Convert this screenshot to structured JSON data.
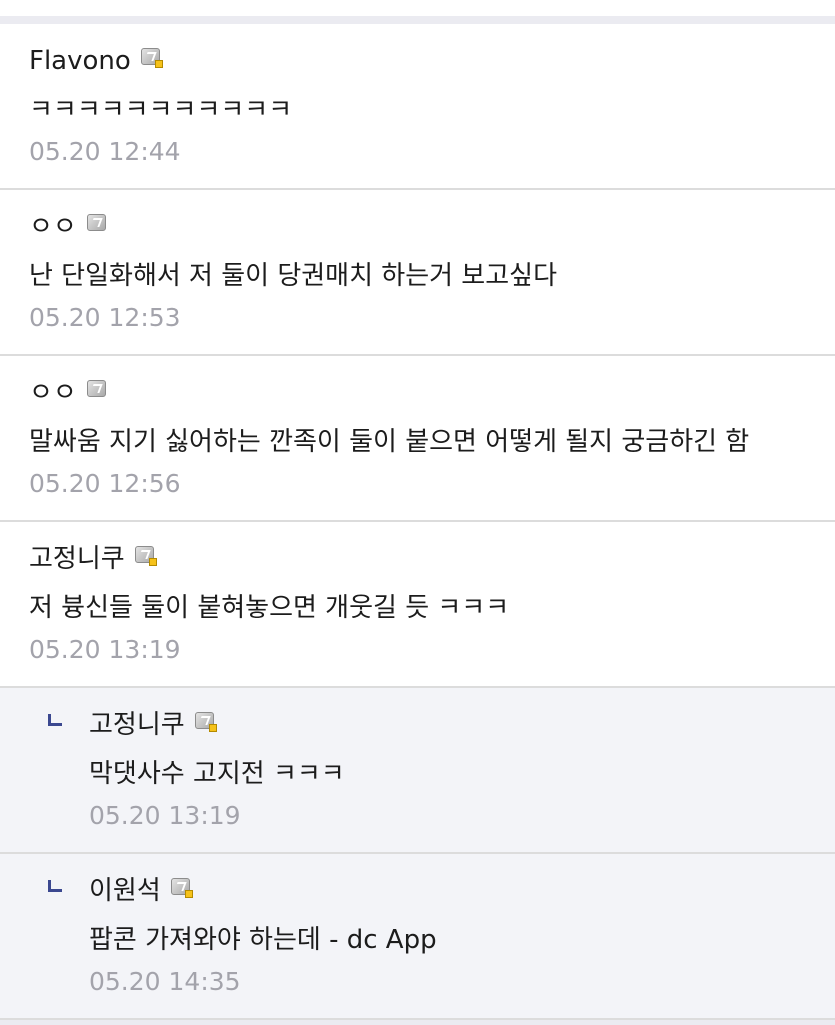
{
  "comments": [
    {
      "nick": "Flavono",
      "icon": "fixed-nick-icon",
      "text": "ㅋㅋㅋㅋㅋㅋㅋㅋㅋㅋㅋ",
      "time": "05.20 12:44",
      "reply": false
    },
    {
      "nick": "ㅇㅇ",
      "icon": "floating-nick-icon",
      "text": "난 단일화해서 저 둘이 당권매치 하는거 보고싶다",
      "time": "05.20 12:53",
      "reply": false
    },
    {
      "nick": "ㅇㅇ",
      "icon": "floating-nick-icon",
      "text": "말싸움 지기 싫어하는 깐족이 둘이 붙으면 어떻게 될지 궁금하긴 함",
      "time": "05.20 12:56",
      "reply": false
    },
    {
      "nick": "고정니쿠",
      "icon": "fixed-nick-icon",
      "text": "저 븅신들 둘이 붙혀놓으면 개웃길 듯 ㅋㅋㅋ",
      "time": "05.20 13:19",
      "reply": false
    },
    {
      "nick": "고정니쿠",
      "icon": "fixed-nick-icon",
      "text": "막댓사수 고지전 ㅋㅋㅋ",
      "time": "05.20 13:19",
      "reply": true
    },
    {
      "nick": "이원석",
      "icon": "fixed-nick-icon",
      "text": "팝콘 가져와야 하는데 - dc App",
      "time": "05.20 14:35",
      "reply": true
    }
  ]
}
